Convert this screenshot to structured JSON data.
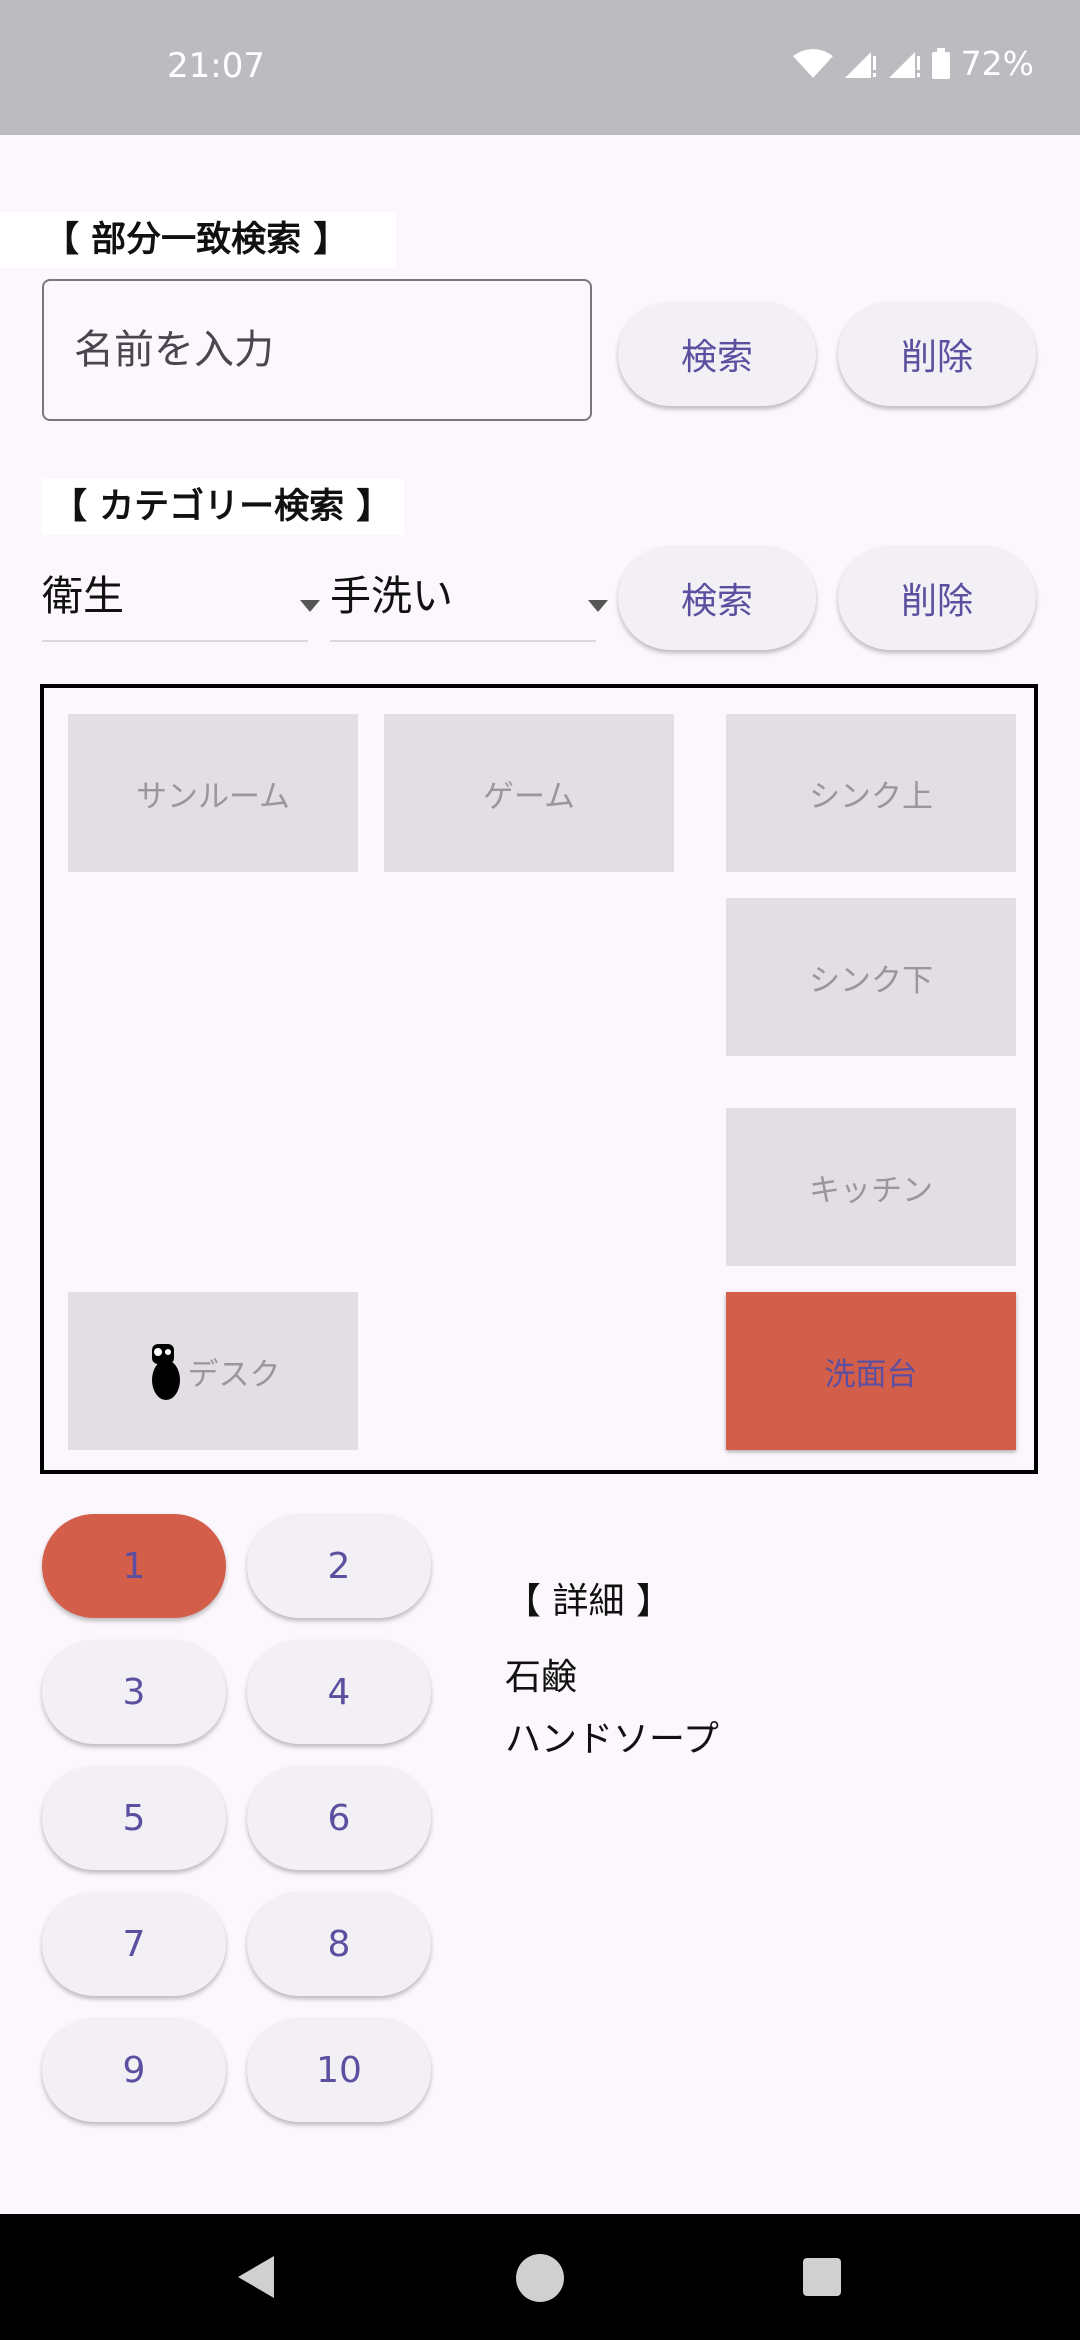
{
  "status_bar": {
    "time": "21:07",
    "battery": "72%"
  },
  "partial_search": {
    "title": "【 部分一致検索 】",
    "placeholder": "名前を入力",
    "value": "",
    "search_label": "検索",
    "delete_label": "削除"
  },
  "category_search": {
    "title": "【 カテゴリー検索 】",
    "category": "衛生",
    "subcategory": "手洗い",
    "search_label": "検索",
    "delete_label": "削除"
  },
  "places": {
    "sunroom": "サンルーム",
    "game": "ゲーム",
    "sink_top": "シンク上",
    "sink_bottom": "シンク下",
    "kitchen": "キッチン",
    "desk": "デスク",
    "washstand": "洗面台"
  },
  "selected_place": "洗面台",
  "pages": [
    "1",
    "2",
    "3",
    "4",
    "5",
    "6",
    "7",
    "8",
    "9",
    "10"
  ],
  "selected_page": "1",
  "detail": {
    "title": "【 詳細 】",
    "lines": [
      "石鹸",
      "ハンドソープ"
    ]
  },
  "colors": {
    "accent": "#d35f4b",
    "button_text": "#5d4fa0",
    "status_bar": "#bcbbbf"
  }
}
